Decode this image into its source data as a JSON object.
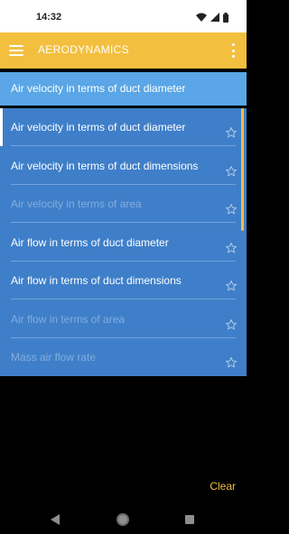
{
  "status_bar": {
    "time": "14:32",
    "icons": [
      "wifi-icon",
      "signal-icon",
      "battery-icon"
    ]
  },
  "app_bar": {
    "title": "AERODYNAMICS",
    "menu_icon": "hamburger-menu-icon",
    "overflow_icon": "more-vert-icon"
  },
  "selected_header": {
    "label": "Air velocity in terms of duct diameter"
  },
  "list": {
    "items": [
      {
        "label": "Air velocity in terms of duct diameter",
        "enabled": true,
        "active": true
      },
      {
        "label": "Air velocity in terms of duct dimensions",
        "enabled": true,
        "active": false
      },
      {
        "label": "Air velocity in terms of area",
        "enabled": false,
        "active": false
      },
      {
        "label": "Air flow in terms of duct diameter",
        "enabled": true,
        "active": false
      },
      {
        "label": "Air flow in terms of duct dimensions",
        "enabled": true,
        "active": false
      },
      {
        "label": "Air flow in terms of area",
        "enabled": false,
        "active": false
      },
      {
        "label": "Mass air flow rate",
        "enabled": false,
        "active": false
      }
    ],
    "star_icon": "star-outline-icon"
  },
  "footer": {
    "clear_label": "Clear"
  },
  "nav_bar": {
    "icons": [
      "back-icon",
      "home-icon",
      "recents-icon"
    ]
  },
  "colors": {
    "primary": "#f2bf3f",
    "list_background": "#3f7fc9",
    "selected_header": "#5aa6e6"
  }
}
